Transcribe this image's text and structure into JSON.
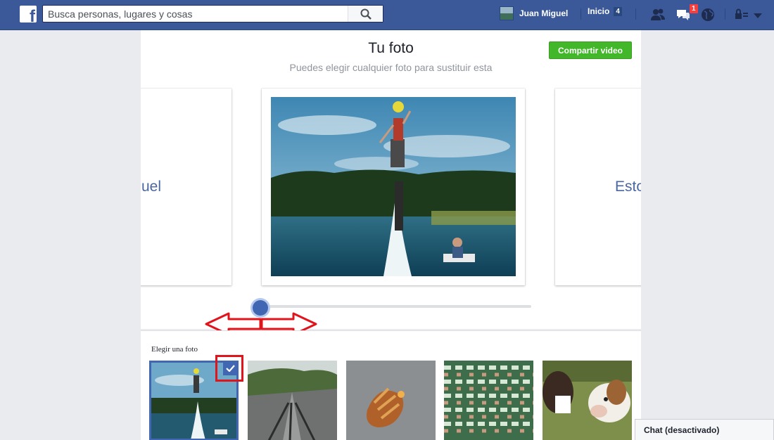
{
  "topbar": {
    "search_placeholder": "Busca personas, lugares y cosas",
    "user_name": "Juan Miguel",
    "home_label": "Inicio",
    "home_count": "4",
    "notification_count": "1",
    "icons": [
      "facebook-logo",
      "search-icon",
      "friends-icon",
      "messages-icon",
      "globe-icon",
      "privacy-lock-icon",
      "dropdown-caret-icon"
    ]
  },
  "panel": {
    "title": "Tu foto",
    "subtitle": "Puedes elegir cualquier foto para sustituir esta",
    "share_button": "Compartir video",
    "left_card_text": "uel",
    "right_card_text": "Esto",
    "slider_position": 0.03
  },
  "chooser": {
    "label": "Elegir una foto",
    "thumbnails": [
      "flyboard",
      "road-shadows",
      "bird-wing",
      "stadium-crowd",
      "boy-and-bulldog"
    ],
    "selected_index": 0
  },
  "chat": {
    "label": "Chat (desactivado)"
  },
  "colors": {
    "topbar": "#3b5998",
    "accent": "#4267b2",
    "share_green": "#42b72a",
    "annotation_red": "#e0141b"
  }
}
